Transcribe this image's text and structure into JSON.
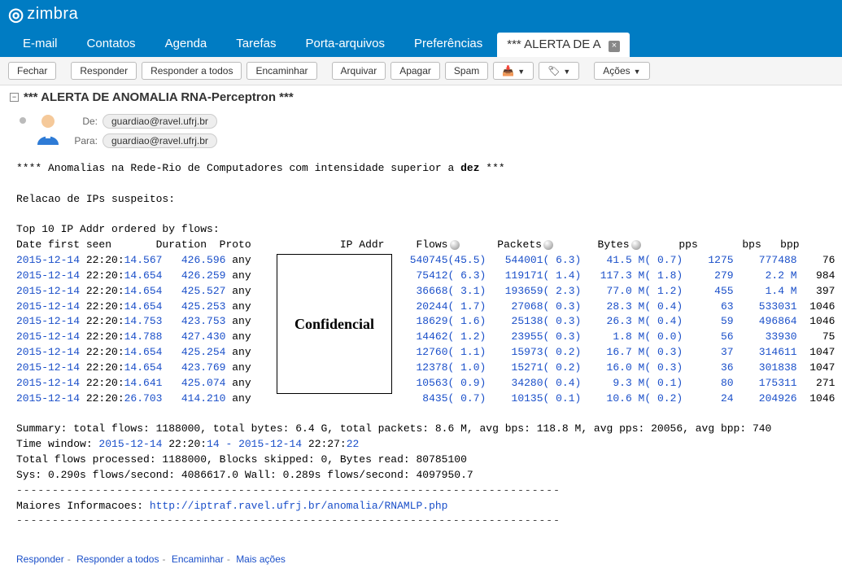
{
  "app": {
    "brand": "zimbra"
  },
  "tabs": {
    "items": [
      {
        "label": "E-mail"
      },
      {
        "label": "Contatos"
      },
      {
        "label": "Agenda"
      },
      {
        "label": "Tarefas"
      },
      {
        "label": "Porta-arquivos"
      },
      {
        "label": "Preferências"
      }
    ],
    "active": {
      "label": "*** ALERTA DE A"
    }
  },
  "toolbar": {
    "close": "Fechar",
    "reply": "Responder",
    "reply_all": "Responder a todos",
    "forward": "Encaminhar",
    "archive": "Arquivar",
    "delete": "Apagar",
    "spam": "Spam",
    "actions": "Ações"
  },
  "message": {
    "subject": "*** ALERTA DE ANOMALIA RNA-Perceptron ***",
    "from_label": "De:",
    "to_label": "Para:",
    "from": "guardiao@ravel.ufrj.br",
    "to": "guardiao@ravel.ufrj.br"
  },
  "body": {
    "intro_prefix": "**** Anomalias na Rede-Rio de Computadores com intensidade superior a ",
    "intro_bold": "dez",
    "intro_suffix": "  ***",
    "relacao": "Relacao de IPs suspeitos:",
    "top10": "Top 10 IP Addr ordered by flows:",
    "hdr": {
      "date": "Date first seen",
      "duration": "Duration",
      "proto": "Proto",
      "ip": "IP Addr",
      "flows": "Flows",
      "packets": "Packets",
      "bytes": "Bytes",
      "pps": "pps",
      "bps": "bps",
      "bpp": "bpp"
    },
    "rows": [
      {
        "d": "2015-12-14",
        "t": "22:20:",
        "s": "14.567",
        "dur": "426.596",
        "pr": "any",
        "flows": "540745(45.5)",
        "pkts": "544001( 6.3)",
        "bytes": "41.5 M( 0.7)",
        "pps": "1275",
        "bps": "777488",
        "bpp": "76"
      },
      {
        "d": "2015-12-14",
        "t": "22:20:",
        "s": "14.654",
        "dur": "426.259",
        "pr": "any",
        "flows": "75412( 6.3)",
        "pkts": "119171( 1.4)",
        "bytes": "117.3 M( 1.8)",
        "pps": "279",
        "bps": "2.2 M",
        "bpp": "984"
      },
      {
        "d": "2015-12-14",
        "t": "22:20:",
        "s": "14.654",
        "dur": "425.527",
        "pr": "any",
        "flows": "36668( 3.1)",
        "pkts": "193659( 2.3)",
        "bytes": "77.0 M( 1.2)",
        "pps": "455",
        "bps": "1.4 M",
        "bpp": "397"
      },
      {
        "d": "2015-12-14",
        "t": "22:20:",
        "s": "14.654",
        "dur": "425.253",
        "pr": "any",
        "flows": "20244( 1.7)",
        "pkts": "27068( 0.3)",
        "bytes": "28.3 M( 0.4)",
        "pps": "63",
        "bps": "533031",
        "bpp": "1046"
      },
      {
        "d": "2015-12-14",
        "t": "22:20:",
        "s": "14.753",
        "dur": "423.753",
        "pr": "any",
        "flows": "18629( 1.6)",
        "pkts": "25138( 0.3)",
        "bytes": "26.3 M( 0.4)",
        "pps": "59",
        "bps": "496864",
        "bpp": "1046"
      },
      {
        "d": "2015-12-14",
        "t": "22:20:",
        "s": "14.788",
        "dur": "427.430",
        "pr": "any",
        "flows": "14462( 1.2)",
        "pkts": "23955( 0.3)",
        "bytes": "1.8 M( 0.0)",
        "pps": "56",
        "bps": "33930",
        "bpp": "75"
      },
      {
        "d": "2015-12-14",
        "t": "22:20:",
        "s": "14.654",
        "dur": "425.254",
        "pr": "any",
        "flows": "12760( 1.1)",
        "pkts": "15973( 0.2)",
        "bytes": "16.7 M( 0.3)",
        "pps": "37",
        "bps": "314611",
        "bpp": "1047"
      },
      {
        "d": "2015-12-14",
        "t": "22:20:",
        "s": "14.654",
        "dur": "423.769",
        "pr": "any",
        "flows": "12378( 1.0)",
        "pkts": "15271( 0.2)",
        "bytes": "16.0 M( 0.3)",
        "pps": "36",
        "bps": "301838",
        "bpp": "1047"
      },
      {
        "d": "2015-12-14",
        "t": "22:20:",
        "s": "14.641",
        "dur": "425.074",
        "pr": "any",
        "flows": "10563( 0.9)",
        "pkts": "34280( 0.4)",
        "bytes": "9.3 M( 0.1)",
        "pps": "80",
        "bps": "175311",
        "bpp": "271"
      },
      {
        "d": "2015-12-14",
        "t": "22:20:",
        "s": "26.703",
        "dur": "414.210",
        "pr": "any",
        "flows": "8435( 0.7)",
        "pkts": "10135( 0.1)",
        "bytes": "10.6 M( 0.2)",
        "pps": "24",
        "bps": "204926",
        "bpp": "1046"
      }
    ],
    "summary_l1": "Summary: total flows: 1188000, total bytes: 6.4 G, total packets: 8.6 M, avg bps: 118.8 M, avg pps: 20056, avg bpp: 740",
    "time_window_prefix": "Time window: ",
    "time_window_val": "2015-12-14 22:20:14 - 2015-12-14 22:27:22",
    "summary_l3": "Total flows processed: 1188000, Blocks skipped: 0, Bytes read: 80785100",
    "summary_l4": "Sys: 0.290s flows/second: 4086617.0  Wall: 0.289s flows/second: 4097950.7",
    "more_info": "Maiores Informacoes: ",
    "more_info_url": "http://iptraf.ravel.ufrj.br/anomalia/RNAMLP.php",
    "confidential": "Confidencial"
  },
  "footer": {
    "reply": "Responder",
    "reply_all": "Responder a todos",
    "forward": "Encaminhar",
    "more": "Mais ações"
  }
}
